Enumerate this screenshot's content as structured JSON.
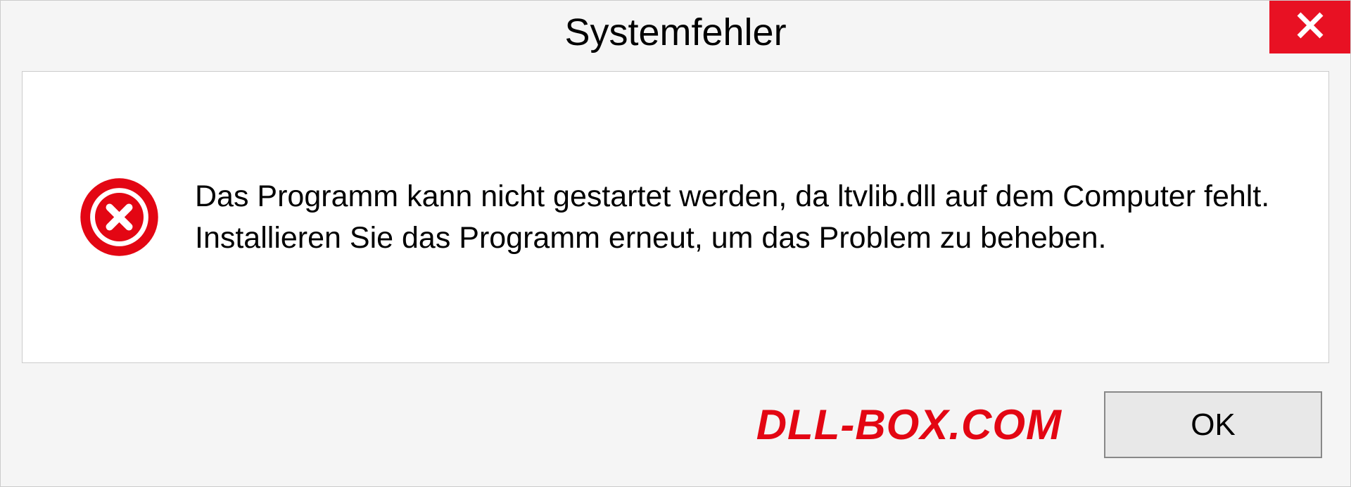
{
  "dialog": {
    "title": "Systemfehler",
    "message": "Das Programm kann nicht gestartet werden, da ltvlib.dll auf dem Computer fehlt. Installieren Sie das Programm erneut, um das Problem zu beheben.",
    "ok_label": "OK"
  },
  "watermark": "DLL-BOX.COM"
}
